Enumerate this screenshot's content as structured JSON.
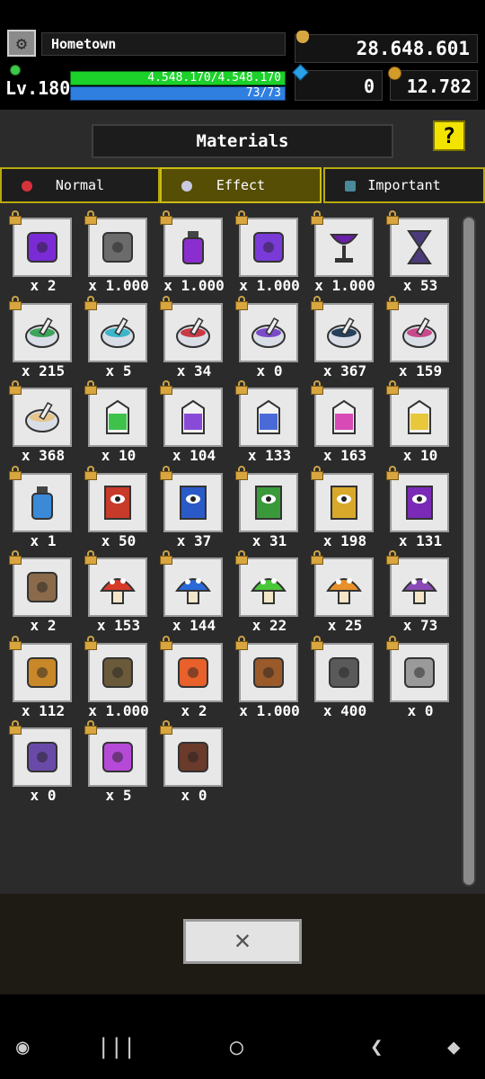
{
  "hud": {
    "location": "Hometown",
    "level": "Lv.180",
    "hp_text": "4.548.170/4.548.170",
    "mp_text": "73/73",
    "gold": "28.648.601",
    "gems": "0",
    "coins": "12.782"
  },
  "panel": {
    "title": "Materials",
    "help_label": "?",
    "tabs": [
      {
        "label": "Normal",
        "active": false,
        "icon": "red-potion-icon"
      },
      {
        "label": "Effect",
        "active": true,
        "icon": "mortar-bowl-icon"
      },
      {
        "label": "Important",
        "active": false,
        "icon": "cube-icon"
      }
    ]
  },
  "items": [
    {
      "name": "dark-cube",
      "count": "x 2",
      "color": "#7a2bd6"
    },
    {
      "name": "dark-bag",
      "count": "x 1.000",
      "color": "#6b6b6b"
    },
    {
      "name": "dark-potion",
      "count": "x 1.000",
      "color": "#8a2ed0"
    },
    {
      "name": "dark-tome",
      "count": "x 1.000",
      "color": "#7a3ad8"
    },
    {
      "name": "dark-chalice",
      "count": "x 1.000",
      "color": "#6a1fa8"
    },
    {
      "name": "hourglass",
      "count": "x 53",
      "color": "#4a3a7a"
    },
    {
      "name": "green-mortar",
      "count": "x 215",
      "color": "#3da55a"
    },
    {
      "name": "cyan-mortar",
      "count": "x 5",
      "color": "#3cb6c8"
    },
    {
      "name": "red-mortar",
      "count": "x 34",
      "color": "#c83a46"
    },
    {
      "name": "purple-mortar",
      "count": "x 0",
      "color": "#7a4ac8"
    },
    {
      "name": "navy-mortar",
      "count": "x 367",
      "color": "#26405a"
    },
    {
      "name": "pink-mortar",
      "count": "x 159",
      "color": "#c84a8a"
    },
    {
      "name": "cream-mortar",
      "count": "x 368",
      "color": "#e6c48a"
    },
    {
      "name": "green-carton",
      "count": "x 10",
      "color": "#3ec24a"
    },
    {
      "name": "violet-carton",
      "count": "x 104",
      "color": "#8a4ad8"
    },
    {
      "name": "blue-carton",
      "count": "x 133",
      "color": "#4a6ad8"
    },
    {
      "name": "magenta-carton",
      "count": "x 163",
      "color": "#d84ab6"
    },
    {
      "name": "yellow-carton",
      "count": "x 10",
      "color": "#e6c83a"
    },
    {
      "name": "lantern",
      "count": "x 1",
      "color": "#3a8ad8"
    },
    {
      "name": "red-eye-book",
      "count": "x 50",
      "color": "#c83a2a"
    },
    {
      "name": "blue-eye-book",
      "count": "x 37",
      "color": "#2a5ac8"
    },
    {
      "name": "green-eye-book",
      "count": "x 31",
      "color": "#3a9a3a"
    },
    {
      "name": "yellow-eye-book",
      "count": "x 198",
      "color": "#d8a82a"
    },
    {
      "name": "purple-eye-book",
      "count": "x 131",
      "color": "#7a2ab6"
    },
    {
      "name": "spell-scroll",
      "count": "x 2",
      "color": "#8a6a4a"
    },
    {
      "name": "red-mushroom",
      "count": "x 153",
      "color": "#d83a2a"
    },
    {
      "name": "blue-mushroom",
      "count": "x 144",
      "color": "#2a6ad8"
    },
    {
      "name": "green-mushroom",
      "count": "x 22",
      "color": "#4ac83a"
    },
    {
      "name": "orange-mushroom",
      "count": "x 25",
      "color": "#e8902a"
    },
    {
      "name": "purple-mushroom",
      "count": "x 73",
      "color": "#8a4ab6"
    },
    {
      "name": "holy-amulet",
      "count": "x 112",
      "color": "#c8882a"
    },
    {
      "name": "beast-medallion",
      "count": "x 1.000",
      "color": "#6a5a3a"
    },
    {
      "name": "fire-cauldron",
      "count": "x 2",
      "color": "#e8602a"
    },
    {
      "name": "steam-engine",
      "count": "x 1.000",
      "color": "#9a5a2a"
    },
    {
      "name": "iron-helmet",
      "count": "x 400",
      "color": "#5a5a5a"
    },
    {
      "name": "spike-trap",
      "count": "x 0",
      "color": "#9a9a9a"
    },
    {
      "name": "dragon-ring",
      "count": "x 0",
      "color": "#6a4aa8"
    },
    {
      "name": "quill-ink",
      "count": "x 5",
      "color": "#b64ad8"
    },
    {
      "name": "treasure-chest",
      "count": "x 0",
      "color": "#6a3a2a"
    }
  ],
  "bottom": {
    "close_label": "✕"
  },
  "navbar": [
    {
      "name": "game-launcher-icon",
      "label": "◉"
    },
    {
      "name": "recent-apps-icon",
      "label": "|||"
    },
    {
      "name": "home-icon",
      "label": "◯"
    },
    {
      "name": "back-icon",
      "label": "❮"
    },
    {
      "name": "assistant-icon",
      "label": "◆"
    }
  ]
}
